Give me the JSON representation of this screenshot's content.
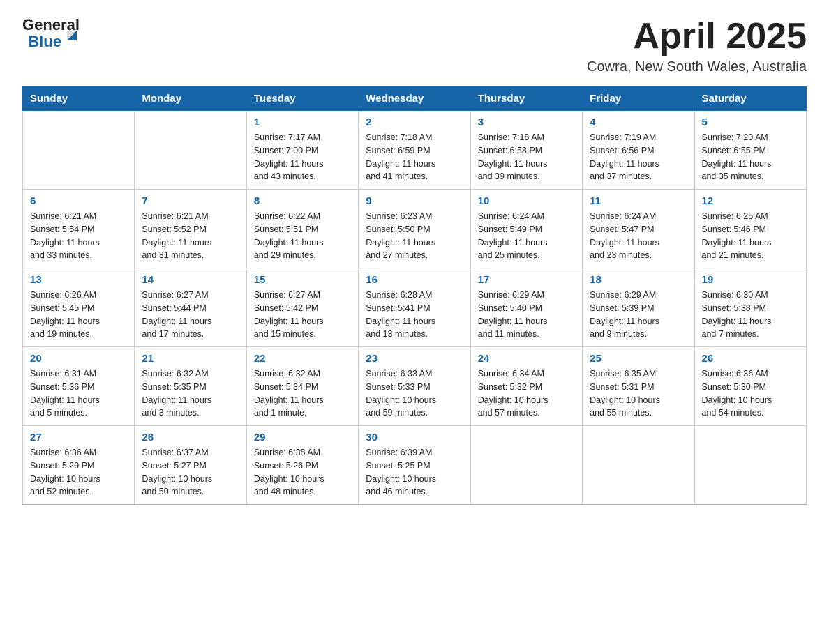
{
  "header": {
    "logo_general": "General",
    "logo_blue": "Blue",
    "title": "April 2025",
    "subtitle": "Cowra, New South Wales, Australia"
  },
  "days_of_week": [
    "Sunday",
    "Monday",
    "Tuesday",
    "Wednesday",
    "Thursday",
    "Friday",
    "Saturday"
  ],
  "weeks": [
    [
      {
        "day": "",
        "info": ""
      },
      {
        "day": "",
        "info": ""
      },
      {
        "day": "1",
        "info": "Sunrise: 7:17 AM\nSunset: 7:00 PM\nDaylight: 11 hours\nand 43 minutes."
      },
      {
        "day": "2",
        "info": "Sunrise: 7:18 AM\nSunset: 6:59 PM\nDaylight: 11 hours\nand 41 minutes."
      },
      {
        "day": "3",
        "info": "Sunrise: 7:18 AM\nSunset: 6:58 PM\nDaylight: 11 hours\nand 39 minutes."
      },
      {
        "day": "4",
        "info": "Sunrise: 7:19 AM\nSunset: 6:56 PM\nDaylight: 11 hours\nand 37 minutes."
      },
      {
        "day": "5",
        "info": "Sunrise: 7:20 AM\nSunset: 6:55 PM\nDaylight: 11 hours\nand 35 minutes."
      }
    ],
    [
      {
        "day": "6",
        "info": "Sunrise: 6:21 AM\nSunset: 5:54 PM\nDaylight: 11 hours\nand 33 minutes."
      },
      {
        "day": "7",
        "info": "Sunrise: 6:21 AM\nSunset: 5:52 PM\nDaylight: 11 hours\nand 31 minutes."
      },
      {
        "day": "8",
        "info": "Sunrise: 6:22 AM\nSunset: 5:51 PM\nDaylight: 11 hours\nand 29 minutes."
      },
      {
        "day": "9",
        "info": "Sunrise: 6:23 AM\nSunset: 5:50 PM\nDaylight: 11 hours\nand 27 minutes."
      },
      {
        "day": "10",
        "info": "Sunrise: 6:24 AM\nSunset: 5:49 PM\nDaylight: 11 hours\nand 25 minutes."
      },
      {
        "day": "11",
        "info": "Sunrise: 6:24 AM\nSunset: 5:47 PM\nDaylight: 11 hours\nand 23 minutes."
      },
      {
        "day": "12",
        "info": "Sunrise: 6:25 AM\nSunset: 5:46 PM\nDaylight: 11 hours\nand 21 minutes."
      }
    ],
    [
      {
        "day": "13",
        "info": "Sunrise: 6:26 AM\nSunset: 5:45 PM\nDaylight: 11 hours\nand 19 minutes."
      },
      {
        "day": "14",
        "info": "Sunrise: 6:27 AM\nSunset: 5:44 PM\nDaylight: 11 hours\nand 17 minutes."
      },
      {
        "day": "15",
        "info": "Sunrise: 6:27 AM\nSunset: 5:42 PM\nDaylight: 11 hours\nand 15 minutes."
      },
      {
        "day": "16",
        "info": "Sunrise: 6:28 AM\nSunset: 5:41 PM\nDaylight: 11 hours\nand 13 minutes."
      },
      {
        "day": "17",
        "info": "Sunrise: 6:29 AM\nSunset: 5:40 PM\nDaylight: 11 hours\nand 11 minutes."
      },
      {
        "day": "18",
        "info": "Sunrise: 6:29 AM\nSunset: 5:39 PM\nDaylight: 11 hours\nand 9 minutes."
      },
      {
        "day": "19",
        "info": "Sunrise: 6:30 AM\nSunset: 5:38 PM\nDaylight: 11 hours\nand 7 minutes."
      }
    ],
    [
      {
        "day": "20",
        "info": "Sunrise: 6:31 AM\nSunset: 5:36 PM\nDaylight: 11 hours\nand 5 minutes."
      },
      {
        "day": "21",
        "info": "Sunrise: 6:32 AM\nSunset: 5:35 PM\nDaylight: 11 hours\nand 3 minutes."
      },
      {
        "day": "22",
        "info": "Sunrise: 6:32 AM\nSunset: 5:34 PM\nDaylight: 11 hours\nand 1 minute."
      },
      {
        "day": "23",
        "info": "Sunrise: 6:33 AM\nSunset: 5:33 PM\nDaylight: 10 hours\nand 59 minutes."
      },
      {
        "day": "24",
        "info": "Sunrise: 6:34 AM\nSunset: 5:32 PM\nDaylight: 10 hours\nand 57 minutes."
      },
      {
        "day": "25",
        "info": "Sunrise: 6:35 AM\nSunset: 5:31 PM\nDaylight: 10 hours\nand 55 minutes."
      },
      {
        "day": "26",
        "info": "Sunrise: 6:36 AM\nSunset: 5:30 PM\nDaylight: 10 hours\nand 54 minutes."
      }
    ],
    [
      {
        "day": "27",
        "info": "Sunrise: 6:36 AM\nSunset: 5:29 PM\nDaylight: 10 hours\nand 52 minutes."
      },
      {
        "day": "28",
        "info": "Sunrise: 6:37 AM\nSunset: 5:27 PM\nDaylight: 10 hours\nand 50 minutes."
      },
      {
        "day": "29",
        "info": "Sunrise: 6:38 AM\nSunset: 5:26 PM\nDaylight: 10 hours\nand 48 minutes."
      },
      {
        "day": "30",
        "info": "Sunrise: 6:39 AM\nSunset: 5:25 PM\nDaylight: 10 hours\nand 46 minutes."
      },
      {
        "day": "",
        "info": ""
      },
      {
        "day": "",
        "info": ""
      },
      {
        "day": "",
        "info": ""
      }
    ]
  ]
}
